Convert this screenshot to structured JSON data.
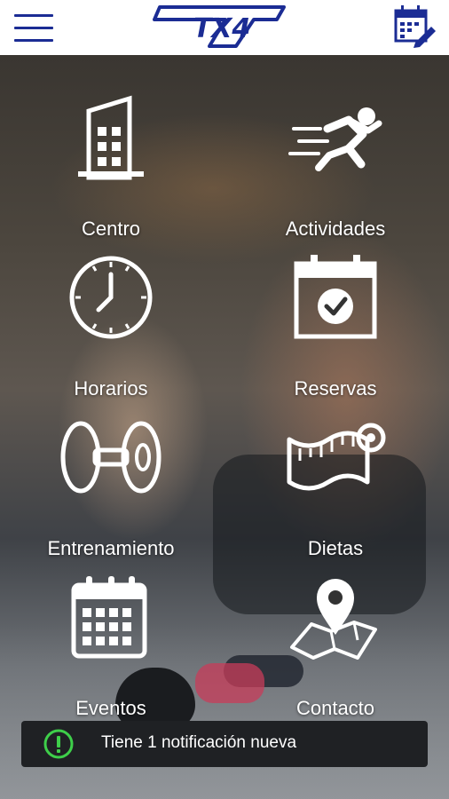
{
  "header": {
    "logo_text": "TX4",
    "brand_color": "#1b2c94",
    "menu_icon": "hamburger-menu-icon",
    "calendar_icon": "calendar-edit-icon"
  },
  "menu": {
    "items": [
      {
        "label": "Centro",
        "icon": "building-icon"
      },
      {
        "label": "Actividades",
        "icon": "runner-icon"
      },
      {
        "label": "Horarios",
        "icon": "clock-icon"
      },
      {
        "label": "Reservas",
        "icon": "calendar-check-icon"
      },
      {
        "label": "Entrenamiento",
        "icon": "dumbbell-icon"
      },
      {
        "label": "Dietas",
        "icon": "measuring-tape-icon"
      },
      {
        "label": "Eventos",
        "icon": "calendar-grid-icon"
      },
      {
        "label": "Contacto",
        "icon": "map-pin-icon"
      }
    ]
  },
  "notification": {
    "message": "Tiene 1 notificación nueva",
    "icon": "alert-circle-icon",
    "icon_color": "#3ecf4a"
  }
}
